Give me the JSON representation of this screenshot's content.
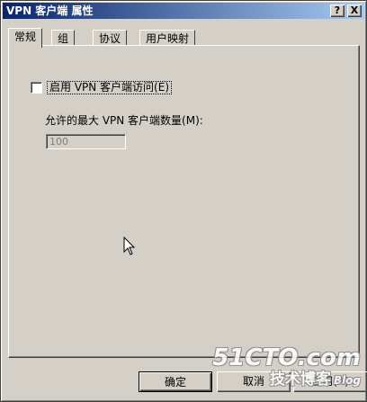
{
  "window": {
    "title": "VPN 客户端 属性",
    "help_button": "?",
    "close_button": "X"
  },
  "tabs": [
    {
      "label": "常规",
      "active": true
    },
    {
      "label": "组",
      "active": false
    },
    {
      "label": "协议",
      "active": false
    },
    {
      "label": "用户映射",
      "active": false
    }
  ],
  "general": {
    "enable_checkbox_label": "启用 VPN 客户端访问(E)",
    "enable_checked": false,
    "max_clients_label": "允许的最大 VPN 客户端数量(M):",
    "max_clients_value": "100"
  },
  "footer": {
    "ok_label": "确定",
    "cancel_label": "取消",
    "apply_label": "应用(A)"
  },
  "watermark": {
    "line1": "51CTO.com",
    "line2": "技术博客",
    "blog": "Blog"
  },
  "colors": {
    "titlebar_start": "#0a246a",
    "titlebar_end": "#a6caf0",
    "dialog_face": "#d4d0c8"
  }
}
